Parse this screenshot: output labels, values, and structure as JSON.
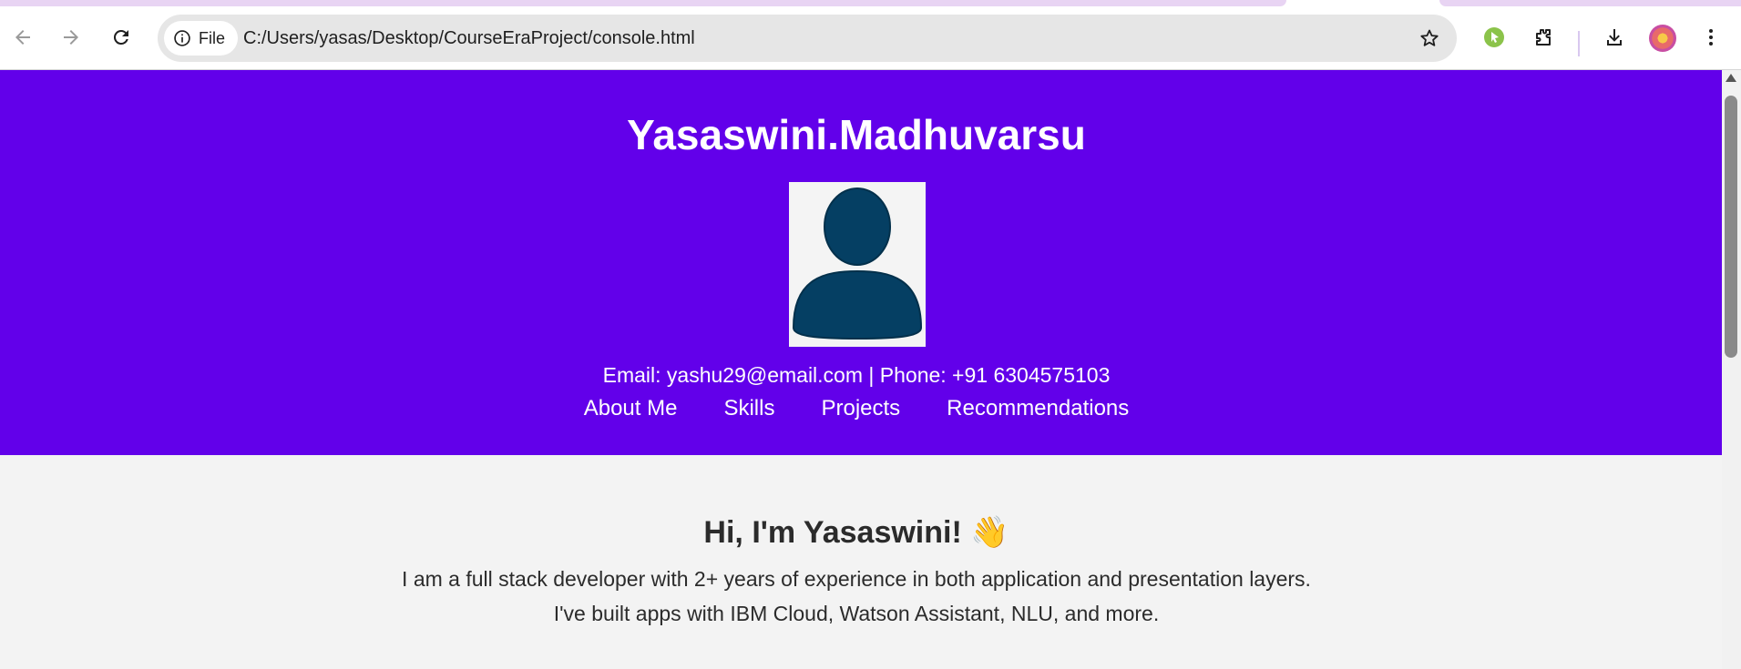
{
  "browser": {
    "site_chip_label": "File",
    "url": "C:/Users/yasas/Desktop/CourseEraProject/console.html",
    "colors": {
      "tab_accent": "#e8d4f3",
      "omnibox_bg": "#e6e6e6"
    }
  },
  "page": {
    "title": "Yasaswini.Madhuvarsu",
    "contact": "Email: yashu29@email.com | Phone: +91 6304575103",
    "nav": [
      "About Me",
      "Skills",
      "Projects",
      "Recommendations"
    ],
    "about": {
      "heading": "Hi, I'm Yasaswini! 👋",
      "line1": "I am a full stack developer with 2+ years of experience in both application and presentation layers.",
      "line2": "I've built apps with IBM Cloud, Watson Assistant, NLU, and more."
    },
    "colors": {
      "hero_bg": "#6200ea",
      "hero_text": "#ffffff",
      "body_bg": "#f3f3f3",
      "avatar_fill": "#053f63"
    }
  }
}
